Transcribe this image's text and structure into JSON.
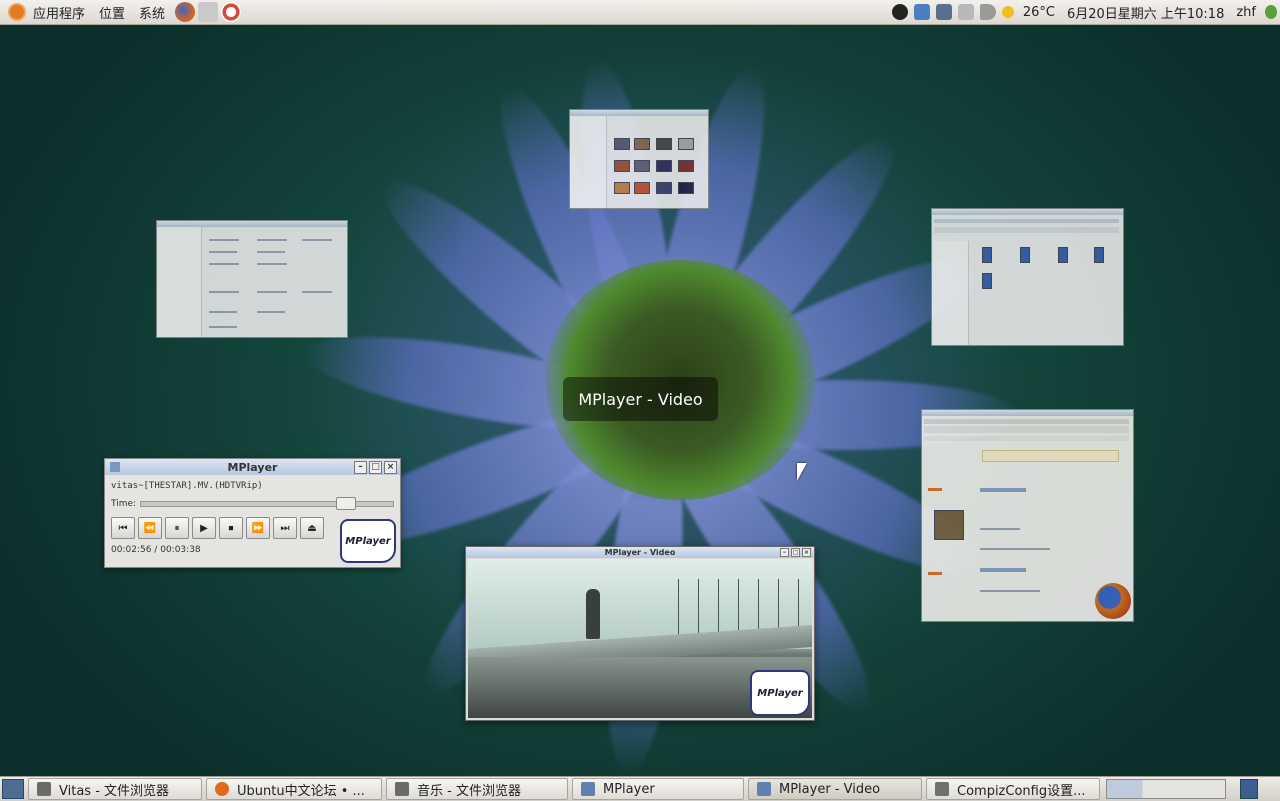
{
  "top_panel": {
    "menus": [
      "应用程序",
      "位置",
      "系统"
    ],
    "temperature": "26°C",
    "datetime": "6月20日星期六 上午10:18",
    "user": "zhf"
  },
  "scale_label": "MPlayer - Video",
  "mplayer": {
    "title": "MPlayer",
    "file": "vitas~[THESTAR].MV.(HDTVRip)",
    "time_label": "Time:",
    "position": "00:02:56",
    "separator": "/",
    "duration": "00:03:38",
    "progress_fraction": 0.81,
    "logo_text": "MPlayer",
    "buttons": [
      "⏮",
      "⏪",
      "⏸",
      "▶",
      "⏹",
      "⏩",
      "⏭",
      "⏏"
    ]
  },
  "video_window": {
    "title": "MPlayer - Video",
    "logo_text": "MPlayer"
  },
  "taskbar": {
    "tasks": [
      {
        "label": "Vitas - 文件浏览器",
        "color": "#6b6b6b"
      },
      {
        "label": "Ubuntu中文论坛 • ...",
        "color": "#e06a1a"
      },
      {
        "label": "音乐 - 文件浏览器",
        "color": "#6b6b6b"
      },
      {
        "label": "MPlayer",
        "color": "#6080b0"
      },
      {
        "label": "MPlayer - Video",
        "color": "#6080b0"
      },
      {
        "label": "CompizConfig设置...",
        "color": "#707070"
      }
    ]
  },
  "colors": {
    "panel_bg": "#dcd8d1",
    "titlebar": "#b6c7dd",
    "desktop": "#14463c"
  }
}
